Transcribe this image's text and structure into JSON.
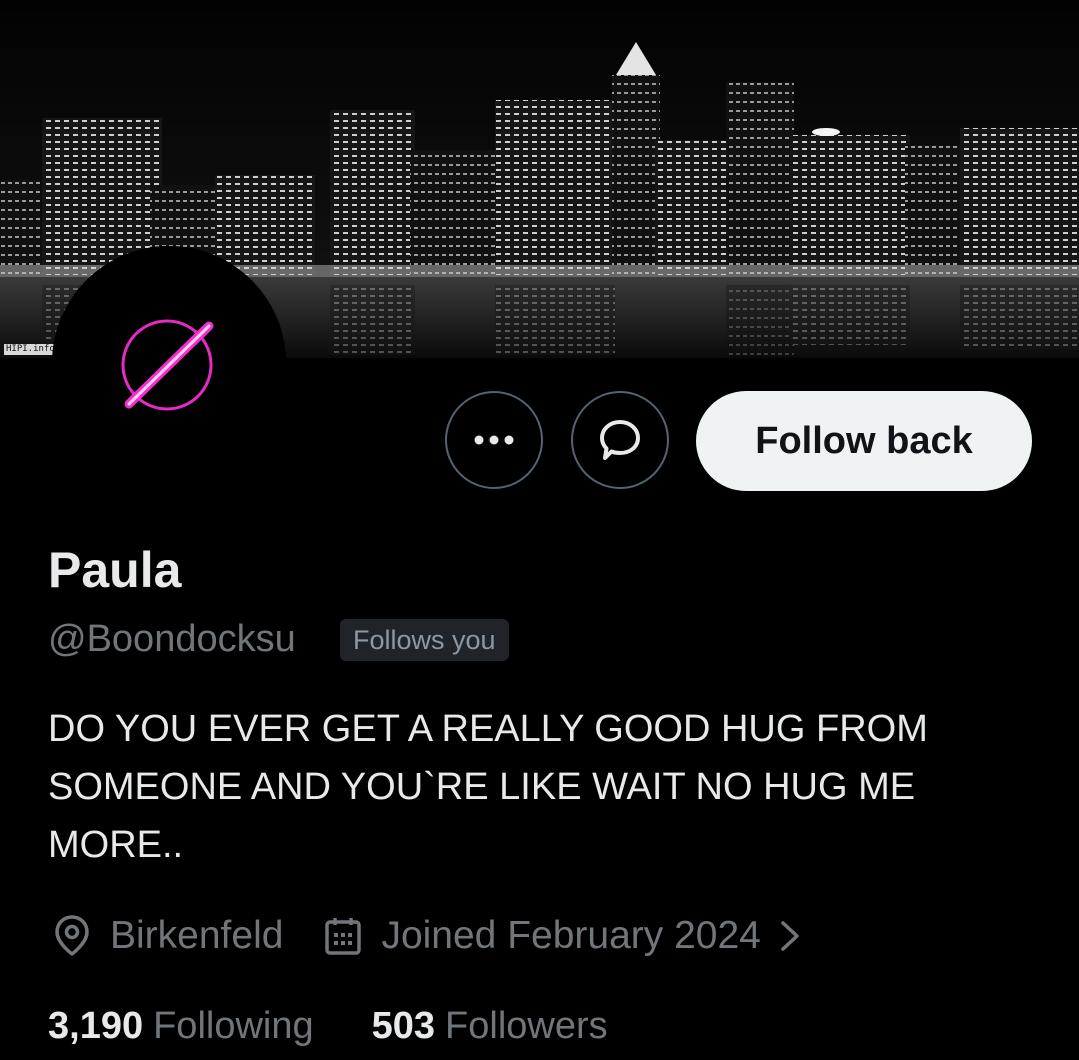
{
  "banner": {
    "watermark": "HIPI.info"
  },
  "profile": {
    "name": "Paula",
    "handle": "@Boondocksu",
    "follows_you_badge": "Follows you",
    "bio": "DO YOU EVER GET A REALLY GOOD HUG FROM SOMEONE AND YOU`RE LIKE WAIT NO HUG ME MORE..",
    "location": "Birkenfeld",
    "joined": "Joined February 2024",
    "following_count": "3,190",
    "following_label": "Following",
    "followers_count": "503",
    "followers_label": "Followers"
  },
  "actions": {
    "more_icon": "more-horizontal-icon",
    "message_icon": "message-icon",
    "follow_back_label": "Follow back"
  },
  "colors": {
    "background": "#000000",
    "text_primary": "#e7e9ea",
    "text_secondary": "#71767b",
    "button_light": "#eff3f4",
    "avatar_accent": "#ff2fd8"
  }
}
